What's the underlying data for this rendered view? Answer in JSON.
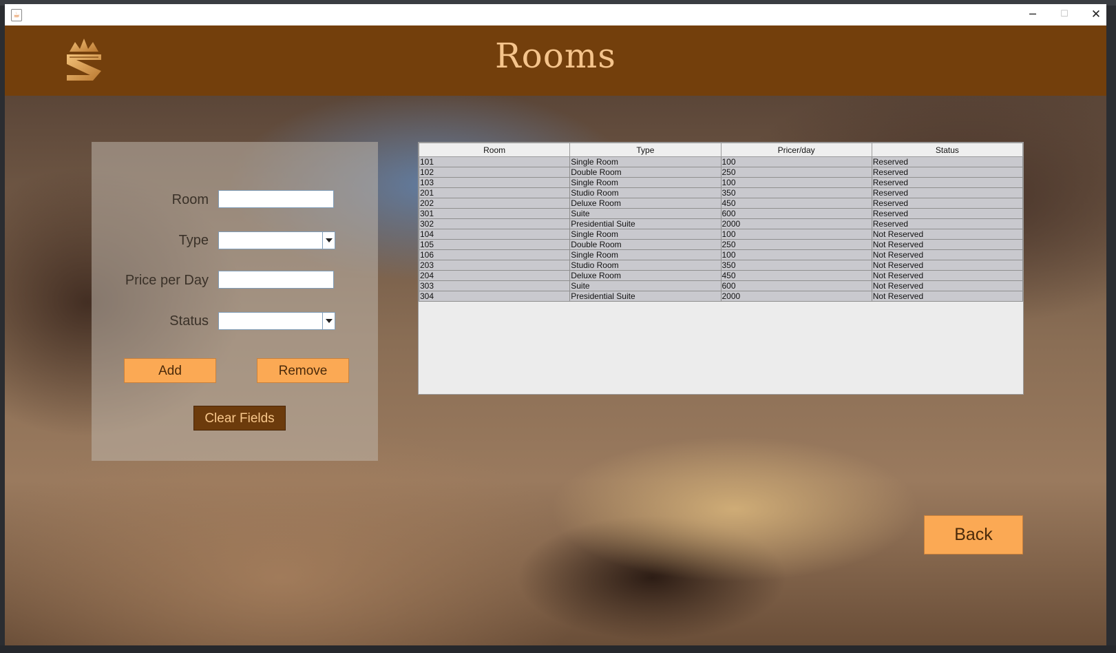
{
  "window": {
    "minimize_glyph": "─",
    "maximize_glyph": "☐",
    "close_glyph": "✕",
    "app_icon_glyph": "☕"
  },
  "header": {
    "title": "Rooms",
    "logo": "crown-s-logo",
    "background_color": "#733f0c",
    "title_color": "#f5c48c"
  },
  "form": {
    "room_label": "Room",
    "room_value": "",
    "type_label": "Type",
    "type_value": "",
    "price_label": "Price per Day",
    "price_value": "",
    "status_label": "Status",
    "status_value": "",
    "add_label": "Add",
    "remove_label": "Remove",
    "clear_label": "Clear Fields"
  },
  "table": {
    "columns": [
      "Room",
      "Type",
      "Pricer/day",
      "Status"
    ],
    "rows": [
      [
        "101",
        "Single Room",
        "100",
        "Reserved"
      ],
      [
        "102",
        "Double Room",
        "250",
        "Reserved"
      ],
      [
        "103",
        "Single Room",
        "100",
        "Reserved"
      ],
      [
        "201",
        "Studio Room",
        "350",
        "Reserved"
      ],
      [
        "202",
        "Deluxe Room",
        "450",
        "Reserved"
      ],
      [
        "301",
        "Suite",
        "600",
        "Reserved"
      ],
      [
        "302",
        "Presidential Suite",
        "2000",
        "Reserved"
      ],
      [
        "104",
        "Single Room",
        "100",
        "Not Reserved"
      ],
      [
        "105",
        "Double Room",
        "250",
        "Not Reserved"
      ],
      [
        "106",
        "Single Room",
        "100",
        "Not Reserved"
      ],
      [
        "203",
        "Studio Room",
        "350",
        "Not Reserved"
      ],
      [
        "204",
        "Deluxe Room",
        "450",
        "Not Reserved"
      ],
      [
        "303",
        "Suite",
        "600",
        "Not Reserved"
      ],
      [
        "304",
        "Presidential Suite",
        "2000",
        "Not Reserved"
      ]
    ]
  },
  "back_label": "Back",
  "colors": {
    "button_light": "#fba954",
    "button_dark": "#6c3b0c"
  }
}
